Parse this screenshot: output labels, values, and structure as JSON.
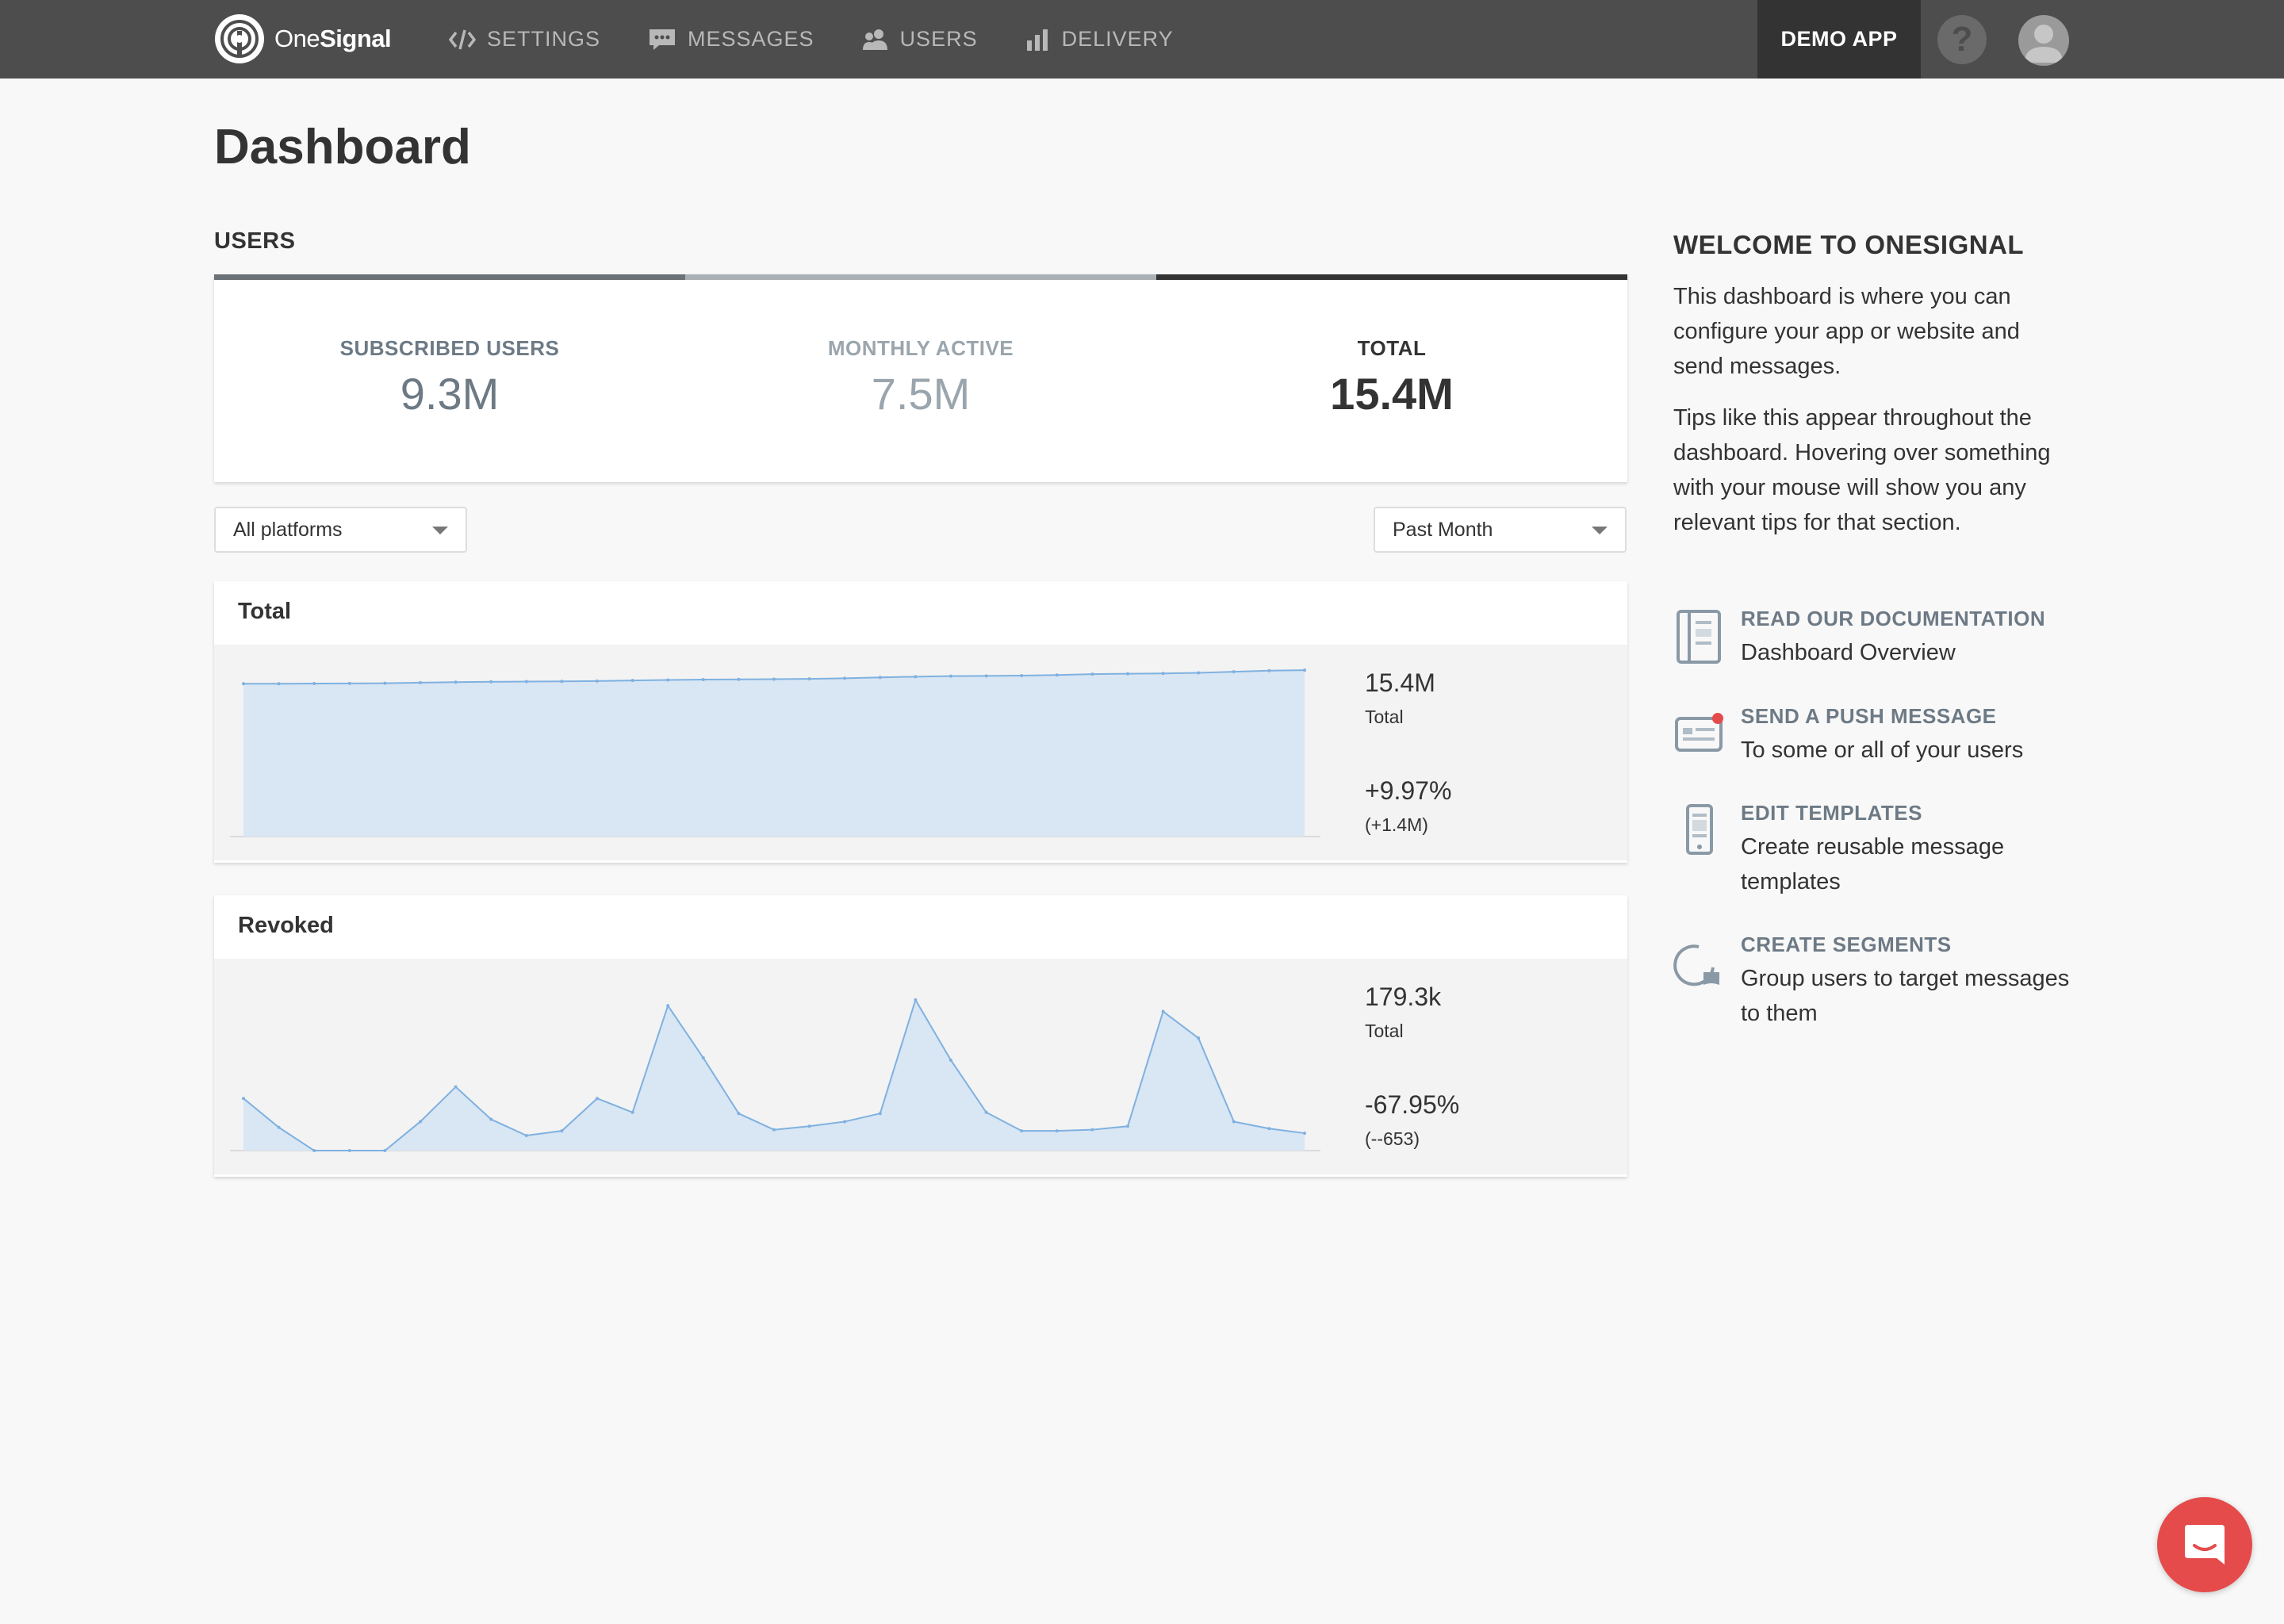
{
  "nav": {
    "logo_text_1": "One",
    "logo_text_2": "Signal",
    "items": [
      {
        "label": "SETTINGS",
        "icon": "code-icon"
      },
      {
        "label": "MESSAGES",
        "icon": "chat-icon"
      },
      {
        "label": "USERS",
        "icon": "users-icon"
      },
      {
        "label": "DELIVERY",
        "icon": "bar-chart-icon"
      }
    ],
    "app_name": "DEMO APP",
    "help": "?"
  },
  "page": {
    "title": "Dashboard"
  },
  "users": {
    "heading": "USERS",
    "stats": [
      {
        "label": "SUBSCRIBED USERS",
        "value": "9.3M",
        "label_color": "#6d7a85",
        "value_color": "#6d7a85",
        "bar_color": "#6b7277"
      },
      {
        "label": "MONTHLY ACTIVE",
        "value": "7.5M",
        "label_color": "#9aa5ad",
        "value_color": "#9aa5ad",
        "bar_color": "#a9b1b6"
      },
      {
        "label": "TOTAL",
        "value": "15.4M",
        "label_color": "#333333",
        "value_color": "#333333",
        "bar_color": "#333333"
      }
    ]
  },
  "filters": {
    "platform": "All platforms",
    "period": "Past Month"
  },
  "colors": {
    "chart_fill": "#d9e6f4",
    "chart_line": "#7fb1e0",
    "chat_button": "#e54b4b"
  },
  "total_chart": {
    "title": "Total",
    "value": "15.4M",
    "value_label": "Total",
    "change": "+9.97%",
    "change_abs": "(+1.4M)"
  },
  "revoked_chart": {
    "title": "Revoked",
    "value": "179.3k",
    "value_label": "Total",
    "change": "-67.95%",
    "change_abs": "(--653)"
  },
  "chart_data": [
    {
      "type": "area",
      "series": [
        {
          "values": [
            14.0,
            14.0,
            14.02,
            14.03,
            14.05,
            14.1,
            14.15,
            14.18,
            14.2,
            14.22,
            14.25,
            14.3,
            14.35,
            14.38,
            14.4,
            14.42,
            14.45,
            14.5,
            14.58,
            14.65,
            14.7,
            14.72,
            14.75,
            14.8,
            14.88,
            14.92,
            14.95,
            15.0,
            15.1,
            15.2,
            15.25
          ]
        }
      ],
      "ylim": [
        0,
        15.4
      ]
    },
    {
      "type": "area",
      "series": [
        {
          "values": [
            4500,
            2000,
            0,
            0,
            0,
            2500,
            5500,
            2700,
            1300,
            1700,
            4500,
            3300,
            12500,
            8000,
            3200,
            1800,
            2100,
            2500,
            3200,
            13000,
            7800,
            3300,
            1700,
            1700,
            1800,
            2100,
            12000,
            9700,
            2500,
            1900,
            1500
          ]
        }
      ],
      "ylim": [
        0,
        14500
      ]
    }
  ],
  "welcome": {
    "title": "WELCOME TO ONESIGNAL",
    "p1": "This dashboard is where you can configure your app or website and send messages.",
    "p2": "Tips like this appear throughout the dashboard. Hovering over something with your mouse will show you any relevant tips for that section."
  },
  "tips": [
    {
      "label": "READ OUR DOCUMENTATION",
      "desc": "Dashboard Overview",
      "icon": "documentation-icon"
    },
    {
      "label": "SEND A PUSH MESSAGE",
      "desc": "To some or all of your users",
      "icon": "push-message-icon"
    },
    {
      "label": "EDIT TEMPLATES",
      "desc": "Create reusable message templates",
      "icon": "template-icon"
    },
    {
      "label": "CREATE SEGMENTS",
      "desc": "Group users to target messages to them",
      "icon": "segment-icon"
    }
  ]
}
